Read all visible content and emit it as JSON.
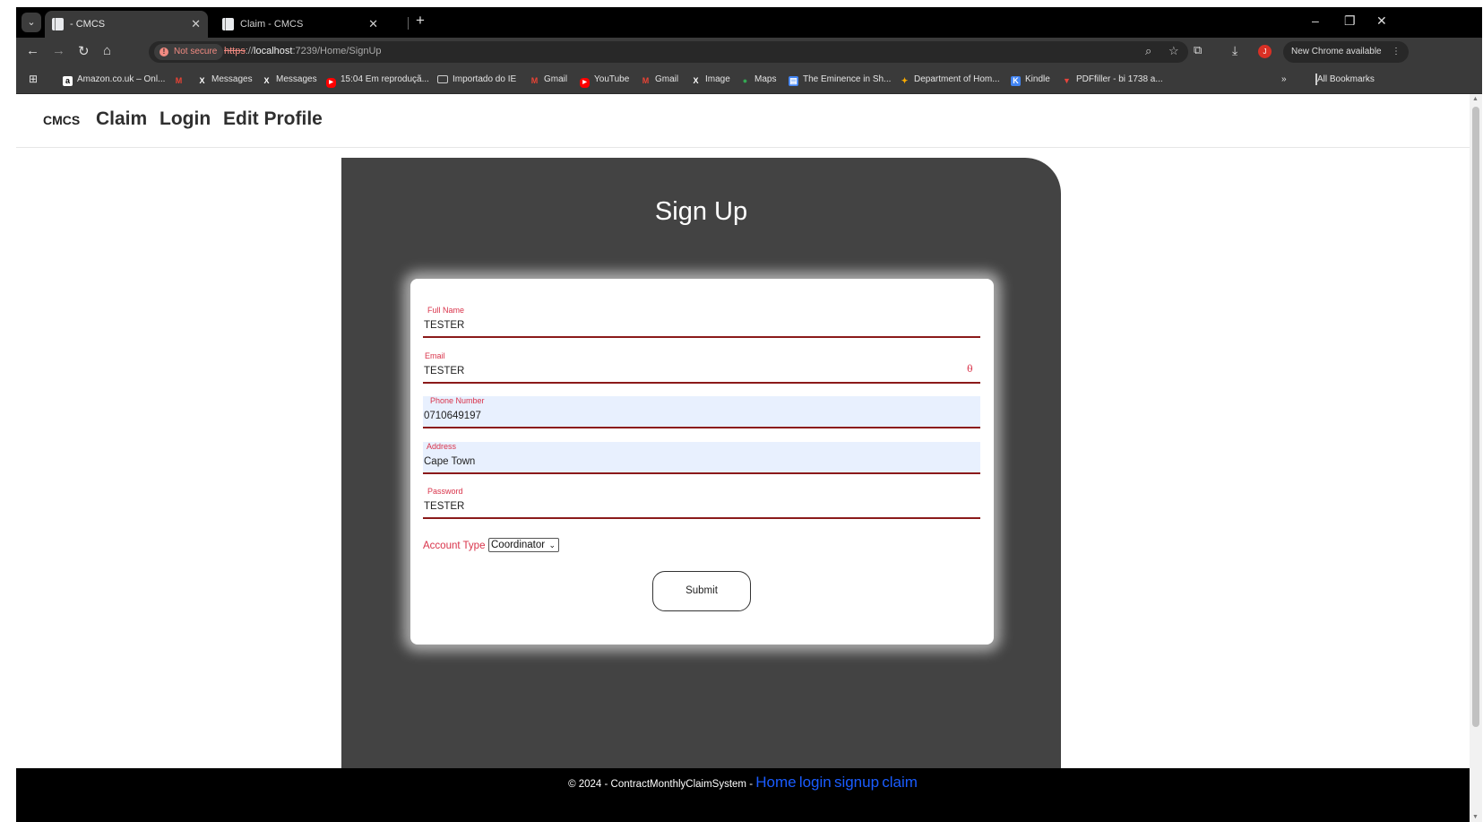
{
  "browser": {
    "tabs": [
      {
        "title": "- CMCS",
        "active": true
      },
      {
        "title": "Claim - CMCS",
        "active": false
      }
    ],
    "security_label": "Not secure",
    "url": {
      "scheme": "https",
      "sep": "://",
      "host": "localhost",
      "rest": ":7239/Home/SignUp"
    },
    "update_label": "New Chrome available",
    "avatar_initial": "J",
    "bookmarks": [
      {
        "label": "Amazon.co.uk – Onl...",
        "icon": "amazon-icon",
        "color": "#ffffff"
      },
      {
        "label": "",
        "icon": "gmail-icon",
        "color": "#ea4335"
      },
      {
        "label": "Messages",
        "icon": "x-icon",
        "color": "#ffffff"
      },
      {
        "label": "Messages",
        "icon": "x-icon",
        "color": "#ffffff"
      },
      {
        "label": "15:04 Em reproduçã...",
        "icon": "youtube-icon",
        "color": "#ff0000"
      },
      {
        "label": "Importado do IE",
        "icon": "folder-icon",
        "color": "#cccccc"
      },
      {
        "label": "Gmail",
        "icon": "gmail-icon",
        "color": "#ea4335"
      },
      {
        "label": "YouTube",
        "icon": "youtube-icon",
        "color": "#ff0000"
      },
      {
        "label": "Gmail",
        "icon": "gmail-icon",
        "color": "#ea4335"
      },
      {
        "label": "Image",
        "icon": "x-icon",
        "color": "#ffffff"
      },
      {
        "label": "Maps",
        "icon": "maps-icon",
        "color": "#34a853"
      },
      {
        "label": "The Eminence in Sh...",
        "icon": "doc-icon",
        "color": "#4285f4"
      },
      {
        "label": "Department of Hom...",
        "icon": "crest-icon",
        "color": "#f9ab00"
      },
      {
        "label": "Kindle",
        "icon": "kindle-icon",
        "color": "#4285f4"
      },
      {
        "label": "PDFfiller - bi 1738 a...",
        "icon": "pdffiller-icon",
        "color": "#e8453c"
      }
    ],
    "all_bookmarks_label": "All Bookmarks"
  },
  "page": {
    "nav": {
      "brand": "CMCS",
      "links": [
        "Claim",
        "Login",
        "Edit Profile"
      ]
    },
    "title": "Sign Up",
    "form": {
      "fields": [
        {
          "label": "Full Name",
          "value": "TESTER",
          "autofilled": false
        },
        {
          "label": "Email",
          "value": "TESTER",
          "autofilled": false
        },
        {
          "label": "Phone Number",
          "value": "0710649197",
          "autofilled": true
        },
        {
          "label": "Address",
          "value": "Cape Town",
          "autofilled": true
        },
        {
          "label": "Password",
          "value": "TESTER",
          "autofilled": false
        }
      ],
      "account_type_label": "Account Type",
      "account_type_value": "Coordinator",
      "submit_label": "Submit"
    },
    "footer": {
      "copyright": "© 2024 - ContractMonthlyClaimSystem -",
      "links": [
        "Home",
        "login",
        "signup",
        "claim"
      ]
    }
  },
  "colors": {
    "card_bg": "#434343",
    "field_accent": "#8b1a1a",
    "label_color": "#d9334a",
    "footer_link": "#1a5cff"
  }
}
